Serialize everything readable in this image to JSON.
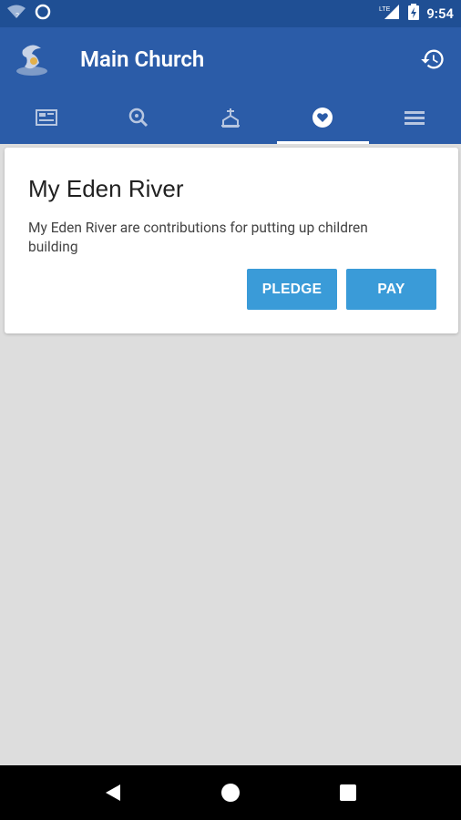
{
  "status_bar": {
    "time": "9:54",
    "network_label": "LTE",
    "icons": [
      "wifi-icon",
      "sync-icon",
      "signal-icon",
      "battery-icon"
    ]
  },
  "app_bar": {
    "title": "Main Church",
    "logo_icon": "church-logo-icon",
    "history_icon": "history-icon"
  },
  "tabs": [
    {
      "icon": "news-icon",
      "active": false
    },
    {
      "icon": "search-icon",
      "active": false
    },
    {
      "icon": "church-icon",
      "active": false
    },
    {
      "icon": "heart-icon",
      "active": true
    },
    {
      "icon": "menu-icon",
      "active": false
    }
  ],
  "card": {
    "title": "My Eden River",
    "description": "My Eden River are contributions for putting up children building",
    "pledge_label": "PLEDGE",
    "pay_label": "PAY"
  },
  "nav_bar": {
    "back_icon": "back-icon",
    "home_icon": "home-icon",
    "recents_icon": "recents-icon"
  },
  "colors": {
    "status_bar": "#1f4f94",
    "app_bar": "#2b5ca8",
    "button": "#3a9bd8",
    "background": "#dddddd"
  }
}
